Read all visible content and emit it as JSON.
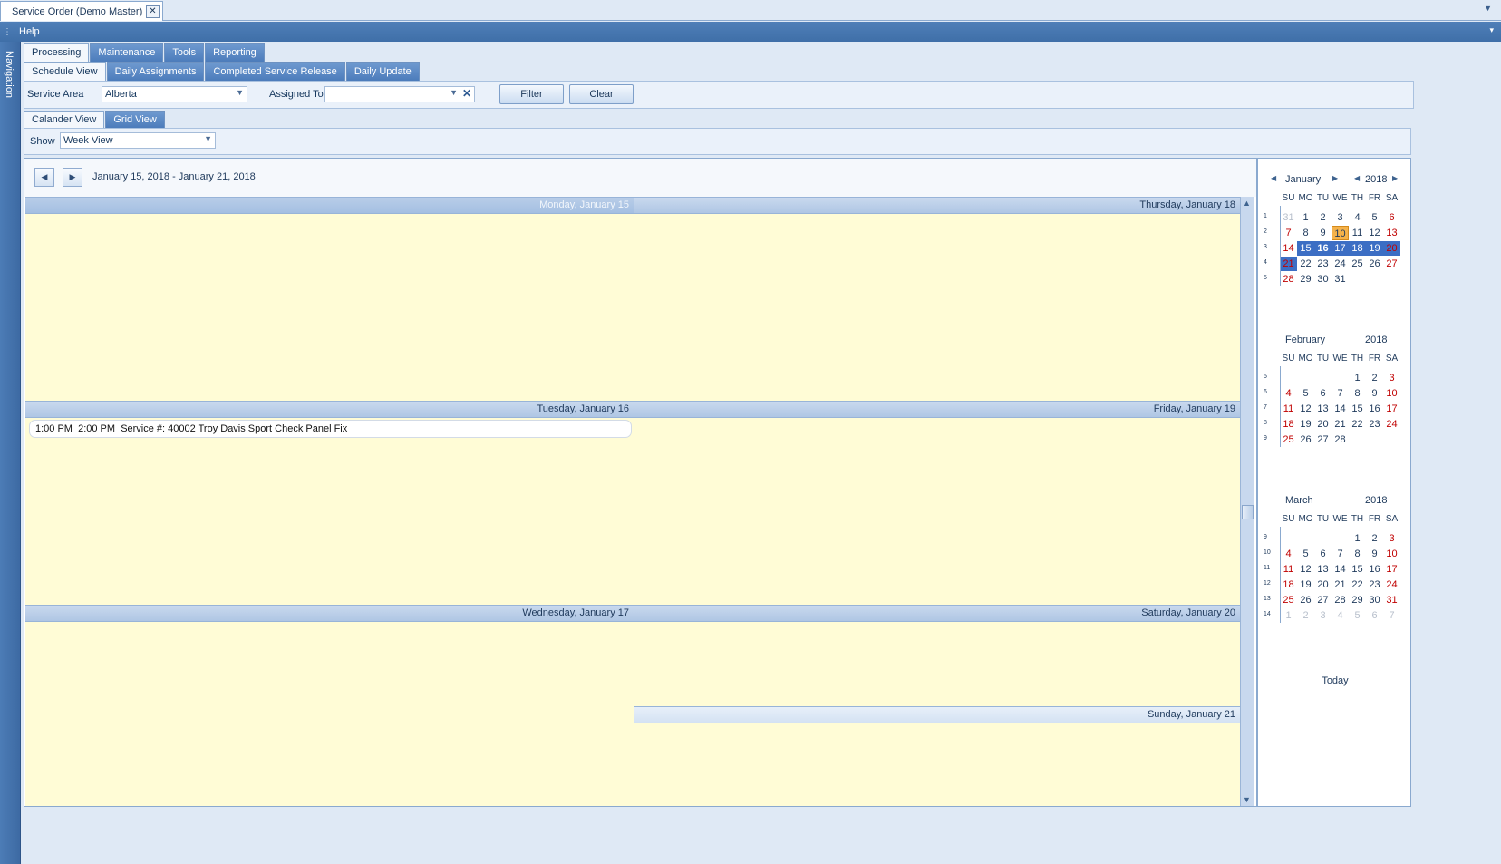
{
  "window": {
    "doc_tab_title": "Service Order (Demo Master)",
    "close_glyph": "✕",
    "menu": [
      "Help"
    ],
    "nav_label": "Navigation"
  },
  "tabs_main": [
    "Processing",
    "Maintenance",
    "Tools",
    "Reporting"
  ],
  "tabs_sub": [
    "Schedule View",
    "Daily Assignments",
    "Completed Service Release",
    "Daily Update"
  ],
  "filter": {
    "service_area_label": "Service Area",
    "service_area_value": "Alberta",
    "assigned_to_label": "Assigned To",
    "assigned_to_value": "",
    "filter_button": "Filter",
    "clear_button": "Clear"
  },
  "view_tabs": [
    "Calander View",
    "Grid View"
  ],
  "show": {
    "label": "Show",
    "value": "Week View"
  },
  "scheduler": {
    "date_range": "January 15, 2018 - January 21, 2018",
    "days": [
      "Monday, January 15",
      "Tuesday, January 16",
      "Wednesday, January 17",
      "Thursday, January 18",
      "Friday, January 19",
      "Saturday, January 20",
      "Sunday, January 21"
    ],
    "appointment": {
      "start": "1:00 PM",
      "end": "2:00 PM",
      "text": "Service #: 40002 Troy Davis Sport Check Panel Fix"
    }
  },
  "date_navigator": {
    "dow": [
      "SU",
      "MO",
      "TU",
      "WE",
      "TH",
      "FR",
      "SA"
    ],
    "today_label": "Today",
    "months": [
      {
        "name": "January",
        "year": "2018",
        "weeks": [
          {
            "wk": "1",
            "days": [
              "31",
              "1",
              "2",
              "3",
              "4",
              "5",
              "6"
            ]
          },
          {
            "wk": "2",
            "days": [
              "7",
              "8",
              "9",
              "10",
              "11",
              "12",
              "13"
            ]
          },
          {
            "wk": "3",
            "days": [
              "14",
              "15",
              "16",
              "17",
              "18",
              "19",
              "20"
            ]
          },
          {
            "wk": "4",
            "days": [
              "21",
              "22",
              "23",
              "24",
              "25",
              "26",
              "27"
            ]
          },
          {
            "wk": "5",
            "days": [
              "28",
              "29",
              "30",
              "31",
              "",
              "",
              ""
            ]
          }
        ]
      },
      {
        "name": "February",
        "year": "2018",
        "weeks": [
          {
            "wk": "5",
            "days": [
              "",
              "",
              "",
              "",
              "1",
              "2",
              "3"
            ]
          },
          {
            "wk": "6",
            "days": [
              "4",
              "5",
              "6",
              "7",
              "8",
              "9",
              "10"
            ]
          },
          {
            "wk": "7",
            "days": [
              "11",
              "12",
              "13",
              "14",
              "15",
              "16",
              "17"
            ]
          },
          {
            "wk": "8",
            "days": [
              "18",
              "19",
              "20",
              "21",
              "22",
              "23",
              "24"
            ]
          },
          {
            "wk": "9",
            "days": [
              "25",
              "26",
              "27",
              "28",
              "",
              "",
              ""
            ]
          }
        ]
      },
      {
        "name": "March",
        "year": "2018",
        "weeks": [
          {
            "wk": "9",
            "days": [
              "",
              "",
              "",
              "",
              "1",
              "2",
              "3"
            ]
          },
          {
            "wk": "10",
            "days": [
              "4",
              "5",
              "6",
              "7",
              "8",
              "9",
              "10"
            ]
          },
          {
            "wk": "11",
            "days": [
              "11",
              "12",
              "13",
              "14",
              "15",
              "16",
              "17"
            ]
          },
          {
            "wk": "12",
            "days": [
              "18",
              "19",
              "20",
              "21",
              "22",
              "23",
              "24"
            ]
          },
          {
            "wk": "13",
            "days": [
              "25",
              "26",
              "27",
              "28",
              "29",
              "30",
              "31"
            ]
          },
          {
            "wk": "14",
            "days": [
              "1",
              "2",
              "3",
              "4",
              "5",
              "6",
              "7"
            ]
          }
        ]
      }
    ]
  }
}
